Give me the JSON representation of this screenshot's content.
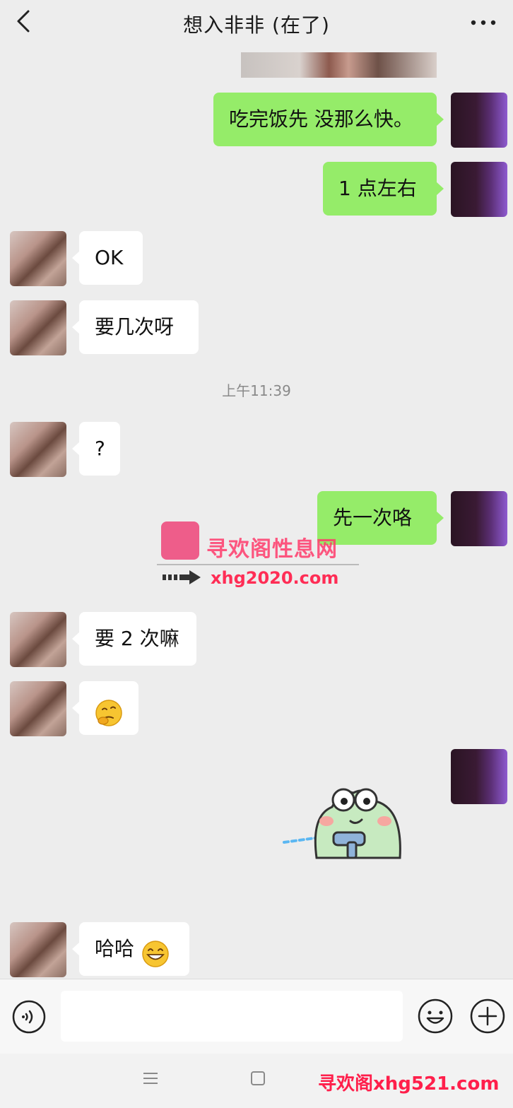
{
  "header": {
    "title": "想入非非 (在了)",
    "back_icon": "chevron-left-icon",
    "more_icon": "more-horizontal-icon"
  },
  "messages": [
    {
      "from": "self",
      "text": "吃完饭先 没那么快。"
    },
    {
      "from": "self",
      "text": "1 点左右"
    },
    {
      "from": "other",
      "text": "OK"
    },
    {
      "from": "other",
      "text": "要几次呀"
    },
    {
      "from": "other",
      "text": "?"
    },
    {
      "from": "self",
      "text": "先一次咯"
    },
    {
      "from": "other",
      "text": "要 2 次嘛"
    },
    {
      "from": "other",
      "text": "",
      "emoji": "thinking-face"
    },
    {
      "from": "self",
      "text": "",
      "sticker": "frog-water-gun-sticker"
    },
    {
      "from": "other",
      "text": "哈哈",
      "emoji": "grinning-face"
    }
  ],
  "timestamp": "上午11:39",
  "watermark": {
    "name": "寻欢阁性息网",
    "url": "xhg2020.com",
    "footer": "寻欢阁xhg521.com"
  },
  "input_bar": {
    "voice_icon": "voice-icon",
    "emoji_icon": "emoji-icon",
    "plus_icon": "plus-icon",
    "placeholder": ""
  },
  "colors": {
    "background": "#ededed",
    "self_bubble": "#95ec69",
    "other_bubble": "#ffffff",
    "watermark": "#ff3b6b"
  }
}
